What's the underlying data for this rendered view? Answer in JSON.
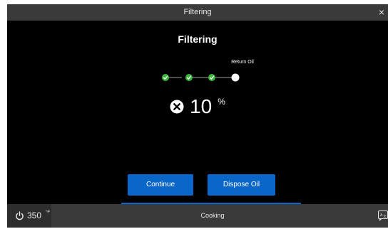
{
  "titlebar": {
    "title": "Filtering",
    "close_label": "×"
  },
  "main": {
    "heading": "Filtering",
    "steps": [
      {
        "state": "done"
      },
      {
        "state": "done"
      },
      {
        "state": "done"
      },
      {
        "state": "current",
        "label": "Return Oil"
      }
    ],
    "status_icon": "circle-x-icon",
    "percent": "10",
    "percent_symbol": "%"
  },
  "buttons": {
    "continue_label": "Continue",
    "dispose_label": "Dispose Oil"
  },
  "bottombar": {
    "temperature": "350",
    "temperature_unit": "°F",
    "mode": "Cooking",
    "power_icon": "power-icon",
    "language_icon": "language-icon"
  },
  "colors": {
    "background": "#000000",
    "bar": "#3a3a3a",
    "accent_blue": "#0a66c9",
    "step_green": "#3db43d"
  }
}
